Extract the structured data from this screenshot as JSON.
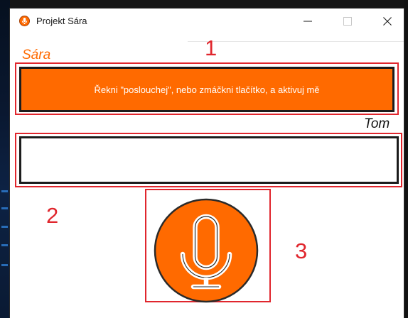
{
  "window": {
    "title": "Projekt Sára",
    "controls": [
      "minimize",
      "maximize",
      "close"
    ]
  },
  "assistant": {
    "name": "Sára",
    "message": "Řekni \"poslouchej\", nebo zmáčkni tlačítko, a aktivuj mě"
  },
  "user": {
    "name": "Tom",
    "input_value": "",
    "input_placeholder": ""
  },
  "mic": {
    "icon": "microphone-icon"
  },
  "annotations": {
    "label_1": "1",
    "label_2": "2",
    "label_3": "3"
  },
  "colors": {
    "accent": "#ff6a00",
    "annotation": "#e0262d",
    "border": "#1c1c1c"
  }
}
